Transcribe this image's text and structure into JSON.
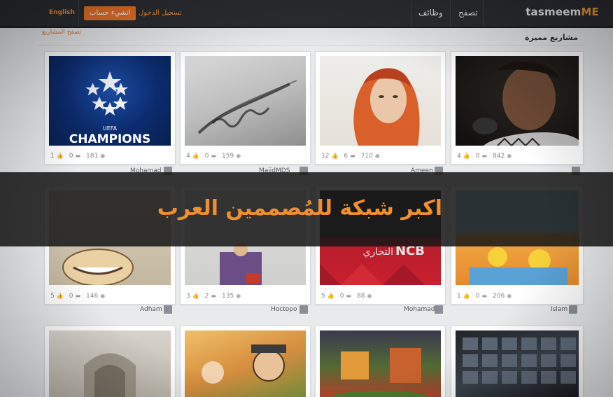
{
  "header": {
    "brand_main": "tasmeem",
    "brand_accent": "ME",
    "nav": [
      "وظائف",
      "تصفح"
    ],
    "login_label": "تسجيل الدخول",
    "signup_label": "انشيء حساب",
    "language_label": "English"
  },
  "section": {
    "title": "مشاريع مميزة",
    "browse_label": "تصفح المشاريع"
  },
  "banner": {
    "text": "اكبر شبكة للمُصممين العرب"
  },
  "cards": [
    {
      "likes": "1",
      "comments": "0",
      "views": "181",
      "author": "Mohamad"
    },
    {
      "likes": "4",
      "comments": "0",
      "views": "159",
      "author": "MajidMDS"
    },
    {
      "likes": "12",
      "comments": "6",
      "views": "710",
      "author": "Ameen"
    },
    {
      "likes": "4",
      "comments": "0",
      "views": "842",
      "author": ""
    },
    {
      "likes": "5",
      "comments": "0",
      "views": "146",
      "author": "Adham"
    },
    {
      "likes": "3",
      "comments": "2",
      "views": "135",
      "author": "Hoctopo"
    },
    {
      "likes": "5",
      "comments": "0",
      "views": "88",
      "author": "Mohamad"
    },
    {
      "likes": "1",
      "comments": "0",
      "views": "206",
      "author": "Islam"
    }
  ],
  "thumbs": {
    "champions_text": "CHAMPIONS",
    "uefa_text": "UEFA",
    "ncb_text": "NCB",
    "ncb_ar": "التجاري"
  },
  "colors": {
    "accent": "#e8722a",
    "topbar": "#2b2d31",
    "banner_text": "#f08f2e"
  }
}
